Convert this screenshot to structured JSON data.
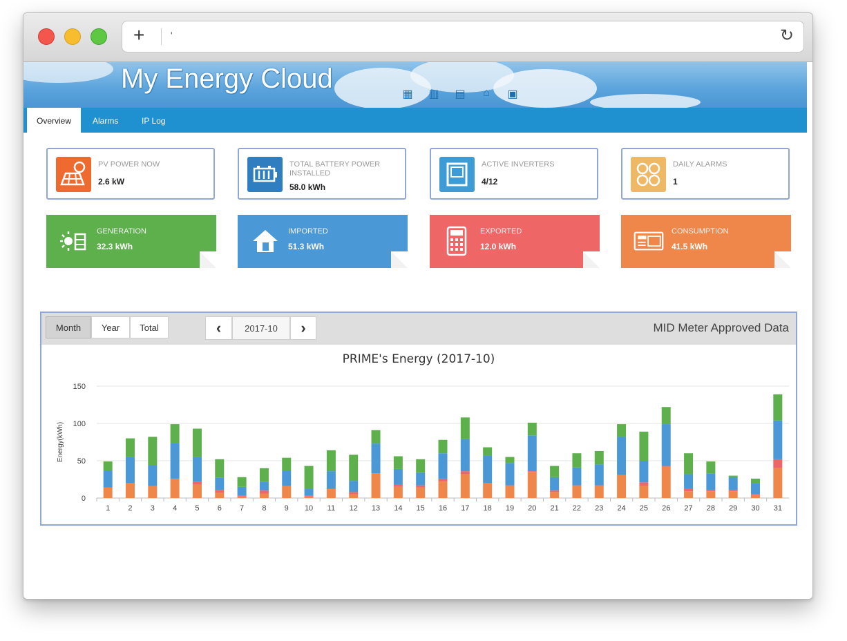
{
  "browser": {
    "url_text": "'",
    "new_tab_glyph": "+",
    "reload_glyph": "↻"
  },
  "app": {
    "title": "My Energy Cloud",
    "nav_icons": [
      "plant-icon",
      "battery-icon",
      "inverter-icon",
      "meter-icon",
      "car-icon"
    ]
  },
  "tabs": [
    {
      "label": "Overview",
      "active": true
    },
    {
      "label": "Alarms",
      "active": false
    },
    {
      "label": "IP Log",
      "active": false
    }
  ],
  "stats": [
    {
      "label": "PV POWER NOW",
      "value": "2.6 kW",
      "icon": "solar-panel-icon",
      "color": "#ef6a2e"
    },
    {
      "label": "TOTAL BATTERY POWER INSTALLED",
      "value": "58.0 kWh",
      "icon": "battery-icon",
      "color": "#2f7fc0"
    },
    {
      "label": "ACTIVE INVERTERS",
      "value": "4/12",
      "icon": "inverter-icon",
      "color": "#3d9bd6"
    },
    {
      "label": "DAILY ALARMS",
      "value": "1",
      "icon": "alarm-grid-icon",
      "color": "#eeb865"
    }
  ],
  "tiles": [
    {
      "label": "GENERATION",
      "value": "32.3 kWh",
      "icon": "generation-icon",
      "color": "#5db04b"
    },
    {
      "label": "IMPORTED",
      "value": "51.3 kWh",
      "icon": "house-icon",
      "color": "#4a98d6"
    },
    {
      "label": "EXPORTED",
      "value": "12.0 kWh",
      "icon": "calculator-icon",
      "color": "#ee6666"
    },
    {
      "label": "CONSUMPTION",
      "value": "41.5 kWh",
      "icon": "meter-panel-icon",
      "color": "#f0874a"
    }
  ],
  "chart_panel": {
    "buttons": [
      {
        "label": "Month",
        "active": true
      },
      {
        "label": "Year",
        "active": false
      },
      {
        "label": "Total",
        "active": false
      }
    ],
    "prev_glyph": "‹",
    "next_glyph": "›",
    "period": "2017-10",
    "source_label": "MID Meter Approved Data"
  },
  "chart_data": {
    "type": "bar",
    "stacked": true,
    "title": "PRIME's Energy (2017-10)",
    "ylabel": "Energy(kWh)",
    "xlabel": "",
    "ylim": [
      0,
      150
    ],
    "yticks": [
      0,
      50,
      100,
      150
    ],
    "grid": true,
    "categories": [
      "1",
      "2",
      "3",
      "4",
      "5",
      "6",
      "7",
      "8",
      "9",
      "10",
      "11",
      "12",
      "13",
      "14",
      "15",
      "16",
      "17",
      "18",
      "19",
      "20",
      "21",
      "22",
      "23",
      "24",
      "25",
      "26",
      "27",
      "28",
      "29",
      "30",
      "31"
    ],
    "series": [
      {
        "color": "#f0874a",
        "values": [
          14,
          20,
          16,
          26,
          18,
          7,
          2,
          6,
          16,
          2,
          12,
          5,
          33,
          15,
          14,
          22,
          32,
          20,
          16,
          35,
          8,
          16,
          16,
          31,
          16,
          42,
          9,
          9,
          9,
          4,
          40
        ]
      },
      {
        "color": "#ee6666",
        "values": [
          0,
          0,
          0,
          0,
          4,
          4,
          1,
          4,
          0,
          1,
          1,
          3,
          0,
          3,
          3,
          4,
          4,
          0,
          1,
          1,
          2,
          1,
          1,
          0,
          5,
          1,
          4,
          2,
          2,
          1,
          12
        ]
      },
      {
        "color": "#4a98d6",
        "values": [
          23,
          35,
          28,
          48,
          33,
          16,
          12,
          12,
          21,
          9,
          23,
          15,
          40,
          21,
          17,
          34,
          43,
          37,
          30,
          48,
          18,
          24,
          28,
          51,
          29,
          56,
          19,
          22,
          17,
          15,
          52
        ]
      },
      {
        "color": "#5db04b",
        "values": [
          12,
          25,
          38,
          25,
          38,
          25,
          13,
          18,
          17,
          31,
          28,
          35,
          18,
          17,
          18,
          18,
          29,
          11,
          8,
          17,
          15,
          19,
          18,
          17,
          39,
          23,
          28,
          16,
          2,
          6,
          35
        ]
      }
    ]
  }
}
